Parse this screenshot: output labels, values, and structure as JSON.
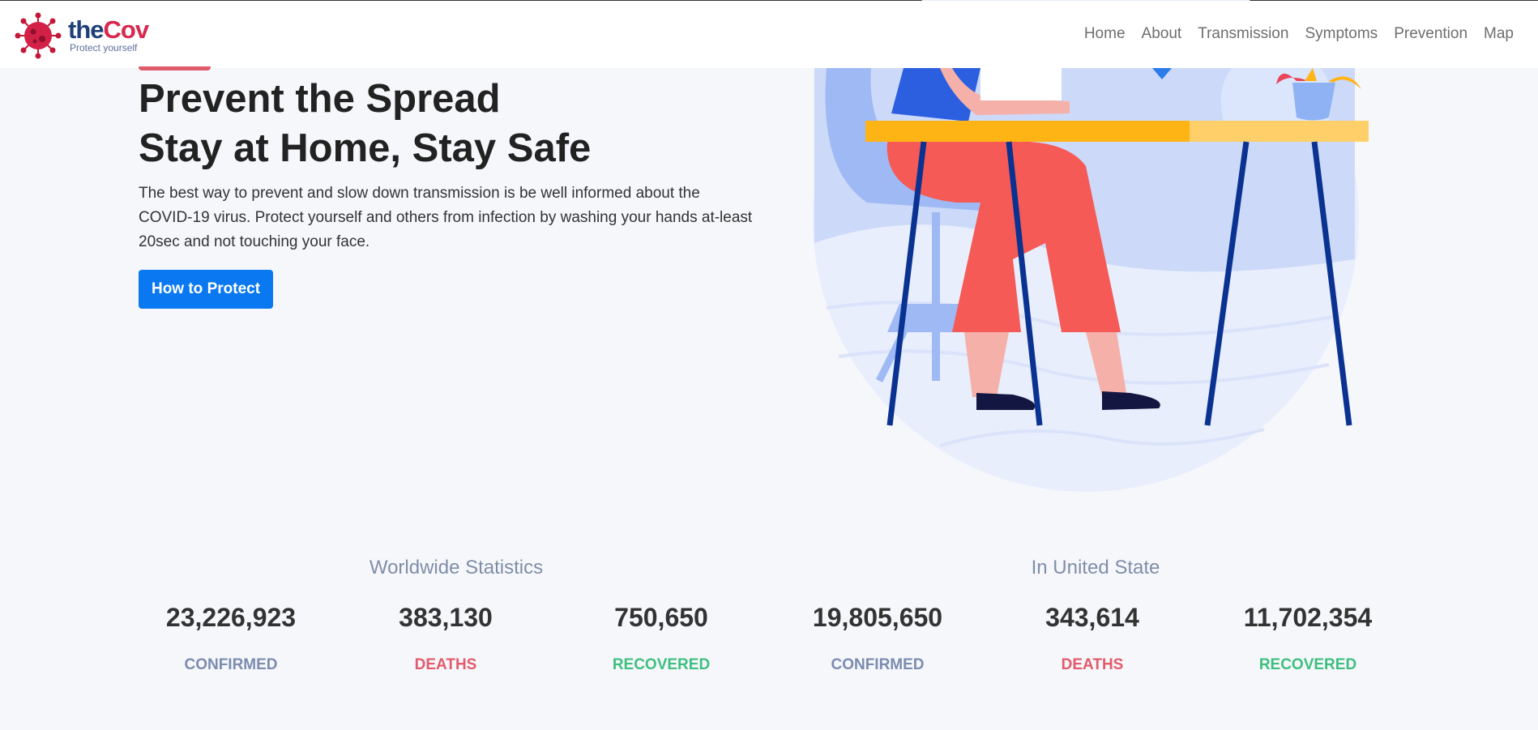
{
  "brand": {
    "name_part1": "the",
    "name_part2": "Cov",
    "tagline": "Protect yourself"
  },
  "nav": [
    "Home",
    "About",
    "Transmission",
    "Symptoms",
    "Prevention",
    "Map"
  ],
  "hero": {
    "title_line1": "Prevent the Spread",
    "title_line2": "Stay at Home, Stay Safe",
    "description": "The best way to prevent and slow down transmission is be well informed about the COVID-19 virus. Protect yourself and others from infection by washing your hands at-least 20sec and not touching your face.",
    "button_label": "How to Protect"
  },
  "stats": {
    "worldwide": {
      "title": "Worldwide Statistics",
      "confirmed": "23,226,923",
      "deaths": "383,130",
      "recovered": "750,650"
    },
    "us": {
      "title": "In United State",
      "confirmed": "19,805,650",
      "deaths": "343,614",
      "recovered": "11,702,354"
    },
    "labels": {
      "confirmed": "CONFIRMED",
      "deaths": "DEATHS",
      "recovered": "RECOVERED"
    }
  },
  "colors": {
    "primary_button": "#0a78f0",
    "confirmed": "#7b8cb0",
    "deaths": "#e25b6a",
    "recovered": "#3fbf7f"
  }
}
